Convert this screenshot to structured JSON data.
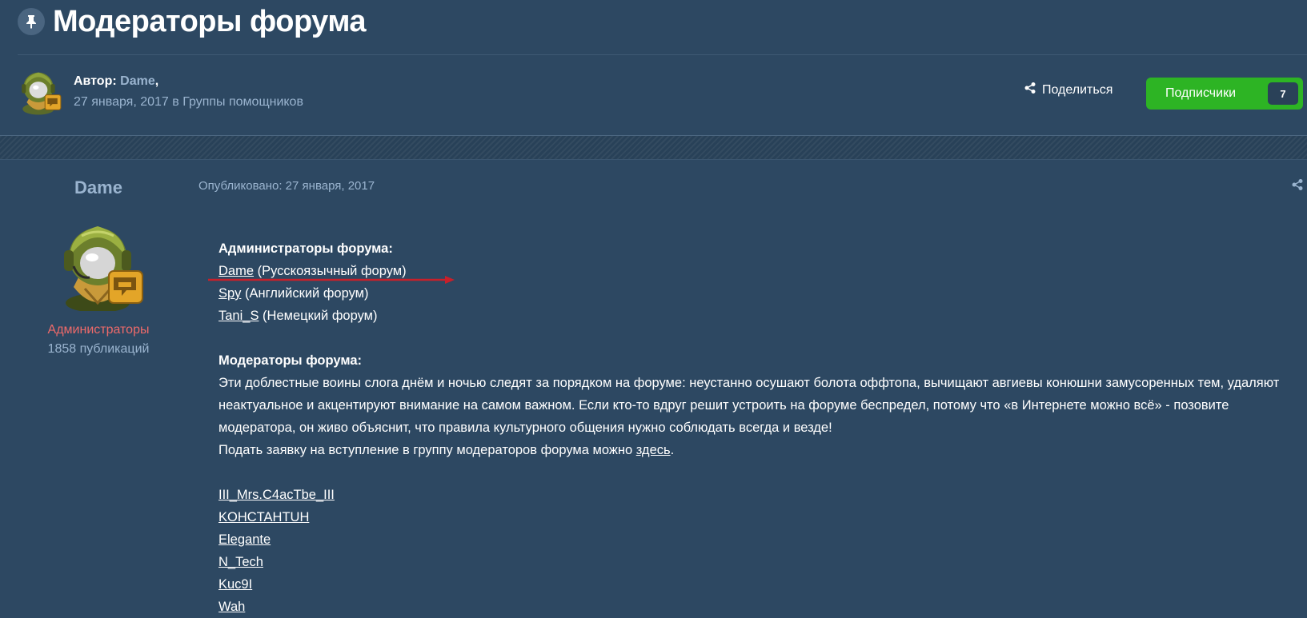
{
  "header": {
    "title": "Модераторы форума",
    "author_label": "Автор:",
    "author_name": "Dame",
    "author_suffix": ",",
    "meta": "27 января, 2017 в Группы помощников",
    "share_label": "Поделиться",
    "follow_label": "Подписчики",
    "follow_count": "7"
  },
  "poster": {
    "name": "Dame",
    "group": "Администраторы",
    "posts": "1858 публикаций"
  },
  "post": {
    "date": "Опубликовано: 27 января, 2017",
    "admins_heading": "Администраторы форума:",
    "admins": [
      {
        "name": "Dame",
        "note": " (Русскоязычный форум)"
      },
      {
        "name": "Spy",
        "note": " (Английский форум)"
      },
      {
        "name": "Tani_S",
        "note": " (Немецкий форум)"
      }
    ],
    "mods_heading": "Модераторы форума:",
    "mods_description": "Эти доблестные воины слога днём и ночью следят за порядком на форуме: неустанно осушают болота оффтопа, вычищают авгиевы конюшни замусоренных тем, удаляют неактуальное и акцентируют внимание на самом важном. Если кто-то вдруг решит устроить на форуме беспредел, потому что «в Интернете можно всё» - позовите модератора, он живо объяснит, что правила культурного общения нужно соблюдать всегда и везде!",
    "apply_text": "Подать заявку на вступление в группу модераторов форума можно ",
    "apply_link": "здесь",
    "apply_end": ".",
    "moderators": [
      "III_Mrs.C4acTbe_III",
      "KOHCTAHTUH",
      "Elegante",
      "N_Tech",
      "Kuc9I",
      "Wah"
    ]
  },
  "colors": {
    "background": "#2d4862",
    "muted_text": "#9ab4cf",
    "accent_green": "#2db424",
    "group_red": "#ef6a6a",
    "arrow_red": "#c8202a"
  },
  "icons": [
    "pin-icon",
    "share-icon",
    "avatar-helmet"
  ]
}
